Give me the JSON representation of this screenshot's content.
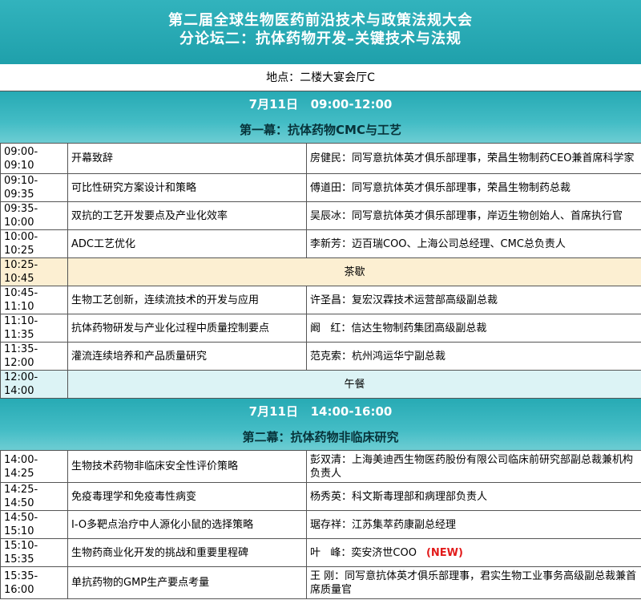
{
  "header": {
    "title_line1": "第二届全球生物医药前沿技术与政策法规大会",
    "title_line2": "分论坛二：抗体药物开发–关键技术与法规"
  },
  "venue": "地点：二楼大宴会厅C",
  "session1": {
    "date_time": "7月11日   09:00-12:00",
    "subtitle": "第一幕：抗体药物CMC与工艺",
    "rows": [
      {
        "time": "09:00-09:10",
        "topic": "开幕致辞",
        "speaker": "房健民：同写意抗体英才俱乐部理事，荣昌生物制药CEO兼首席科学家"
      },
      {
        "time": "09:10-09:35",
        "topic": "可比性研究方案设计和策略",
        "speaker": "傅道田：同写意抗体英才俱乐部理事，荣昌生物制药总裁"
      },
      {
        "time": "09:35-10:00",
        "topic": "双抗的工艺开发要点及产业化效率",
        "speaker": "吴辰冰：同写意抗体英才俱乐部理事，岸迈生物创始人、首席执行官"
      },
      {
        "time": "10:00-10:25",
        "topic": "ADC工艺优化",
        "speaker": "李新芳：迈百瑞COO、上海公司总经理、CMC总负责人"
      }
    ],
    "break": {
      "time": "10:25-10:45",
      "label": "茶歇"
    },
    "rows2": [
      {
        "time": "10:45-11:10",
        "topic": "生物工艺创新，连续流技术的开发与应用",
        "speaker": "许圣昌：复宏汉霖技术运营部高级副总裁"
      },
      {
        "time": "11:10-11:35",
        "topic": "抗体药物研发与产业化过程中质量控制要点",
        "speaker": "阚   红：信达生物制药集团高级副总裁"
      },
      {
        "time": "11:35-12:00",
        "topic": "灌流连续培养和产品质量研究",
        "speaker": "范克索：杭州鸿运华宁副总裁"
      }
    ],
    "lunch": {
      "time": "12:00-14:00",
      "label": "午餐"
    }
  },
  "session2": {
    "date_time": "7月11日   14:00-16:00",
    "subtitle": "第二幕：抗体药物非临床研究",
    "rows": [
      {
        "time": "14:00-14:25",
        "topic": "生物技术药物非临床安全性评价策略",
        "speaker": "彭双清：上海美迪西生物医药股份有限公司临床前研究部副总裁兼机构负责人"
      },
      {
        "time": "14:25-14:50",
        "topic": "免疫毒理学和免疫毒性病变",
        "speaker": "杨秀英：科文斯毒理部和病理部负责人"
      },
      {
        "time": "14:50-15:10",
        "topic": "I-O多靶点治疗中人源化小鼠的选择策略",
        "speaker": "琚存祥：江苏集萃药康副总经理"
      },
      {
        "time": "15:10-15:35",
        "topic": "生物药商业化开发的挑战和重要里程碑",
        "speaker": "叶   峰：奕安济世COO",
        "badge": "(NEW)"
      },
      {
        "time": "15:35-16:00",
        "topic": "单抗药物的GMP生产要点考量",
        "speaker": "王   刚：同写意抗体英才俱乐部理事，君实生物工业事务高级副总裁兼首席质量官"
      }
    ]
  }
}
